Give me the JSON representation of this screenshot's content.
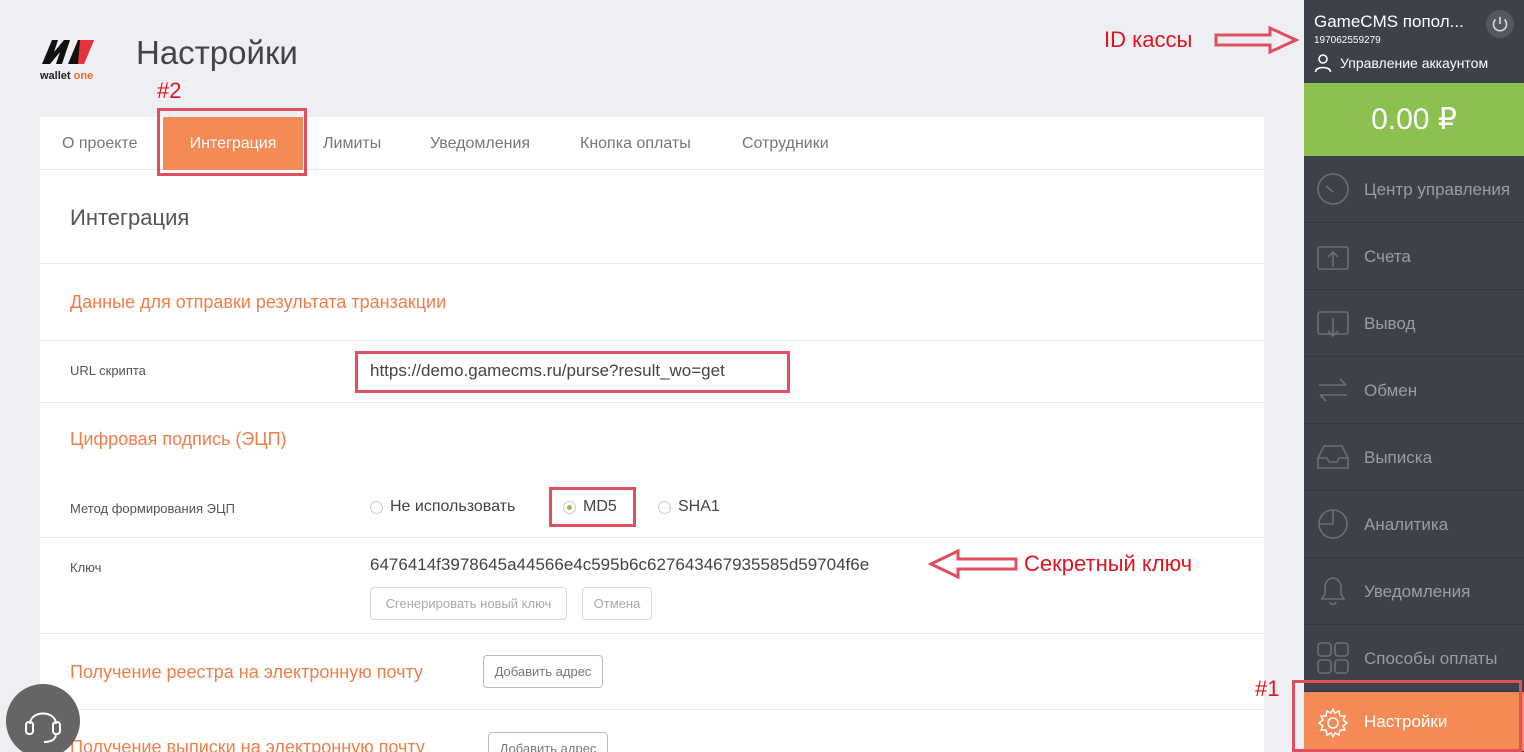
{
  "header": {
    "logo_text": "wallet",
    "logo_text_accent": "one",
    "page_title": "Настройки"
  },
  "tabs": [
    {
      "label": "О проекте"
    },
    {
      "label": "Интеграция"
    },
    {
      "label": "Лимиты"
    },
    {
      "label": "Уведомления"
    },
    {
      "label": "Кнопка оплаты"
    },
    {
      "label": "Сотрудники"
    }
  ],
  "integration": {
    "title": "Интеграция",
    "transaction_section": "Данные для отправки результата транзакции",
    "url_label": "URL скрипта",
    "url_value": "https://demo.gamecms.ru/purse?result_wo=get",
    "signature_section": "Цифровая подпись (ЭЦП)",
    "method_label": "Метод формирования ЭЦП",
    "methods": [
      "Не использовать",
      "MD5",
      "SHA1"
    ],
    "selected_method": "MD5",
    "key_label": "Ключ",
    "key_value": "6476414f3978645a44566e4c595b6c627643467935585d59704f6e",
    "generate_button": "Сгенерировать новый ключ",
    "cancel_button": "Отмена",
    "registry_section": "Получение реестра на электронную почту",
    "add_address_button": "Добавить адрес",
    "statement_section": "Получение выписки на электронную почту",
    "add_address_button_2": "Добавить адрес"
  },
  "annotations": {
    "cash_id": "ID кассы",
    "secret_key": "Секретный ключ",
    "marker_1": "#1",
    "marker_2": "#2"
  },
  "sidebar": {
    "account_name": "GameCMS попол...",
    "account_id": "197062559279",
    "manage_account": "Управление аккаунтом",
    "balance": "0.00 ₽",
    "items": [
      {
        "label": "Центр управления",
        "icon": "speedometer-icon"
      },
      {
        "label": "Счета",
        "icon": "wallet-up-icon"
      },
      {
        "label": "Вывод",
        "icon": "wallet-down-icon"
      },
      {
        "label": "Обмен",
        "icon": "exchange-arrows-icon"
      },
      {
        "label": "Выписка",
        "icon": "inbox-tray-icon"
      },
      {
        "label": "Аналитика",
        "icon": "pie-chart-icon"
      },
      {
        "label": "Уведомления",
        "icon": "bell-icon"
      },
      {
        "label": "Способы оплаты",
        "icon": "grid-icon"
      },
      {
        "label": "Настройки",
        "icon": "gear-icon"
      }
    ],
    "active_item": "Настройки"
  },
  "colors": {
    "accent_orange": "#f68a57",
    "balance_green": "#8cc152",
    "sidebar_bg": "#3d414a",
    "annotation_red": "#e0141e"
  }
}
